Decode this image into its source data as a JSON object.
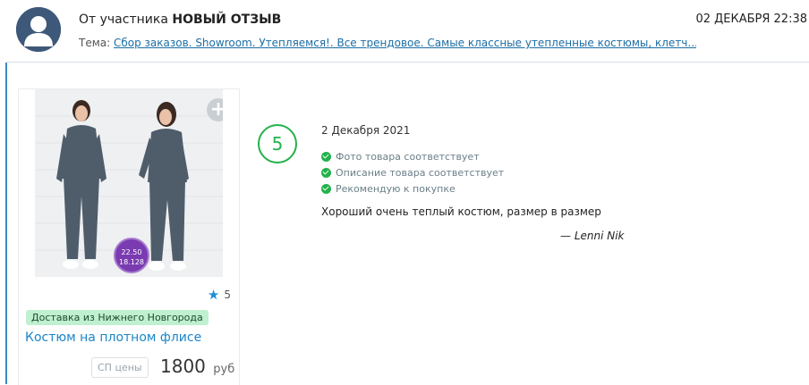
{
  "header": {
    "from_prefix": "От участника",
    "from_event": "НОВЫЙ ОТЗЫВ",
    "date": "02 ДЕКАБРЯ 22:38",
    "subject_label": "Тема:",
    "subject_link": "Сбор заказов. Showroom. Утепляемся!. Все трендовое. Самые классные утепленные костюмы, клетч..."
  },
  "product": {
    "size_badge_line1": "22.50",
    "size_badge_line2": "18.128",
    "rating": "5",
    "delivery": "Доставка из Нижнего Новгорода",
    "title": "Костюм на плотном флисе",
    "price_label": "СП цены",
    "price": "1800",
    "currency": "руб"
  },
  "review": {
    "score": "5",
    "date": "2 Декабря 2021",
    "checks": [
      "Фото товара соответствует",
      "Описание товара соответствует",
      "Рекомендую к покупке"
    ],
    "text": "Хороший очень теплый костюм, размер в размер",
    "author": "— Lenni Nik"
  },
  "colors": {
    "accent_blue": "#1a86c7",
    "score_green": "#21b24b",
    "badge_green_bg": "#bff0cf",
    "avatar_bg": "#3d5878"
  },
  "icons": [
    "avatar-icon",
    "plus-icon",
    "star-icon",
    "check-icon"
  ]
}
